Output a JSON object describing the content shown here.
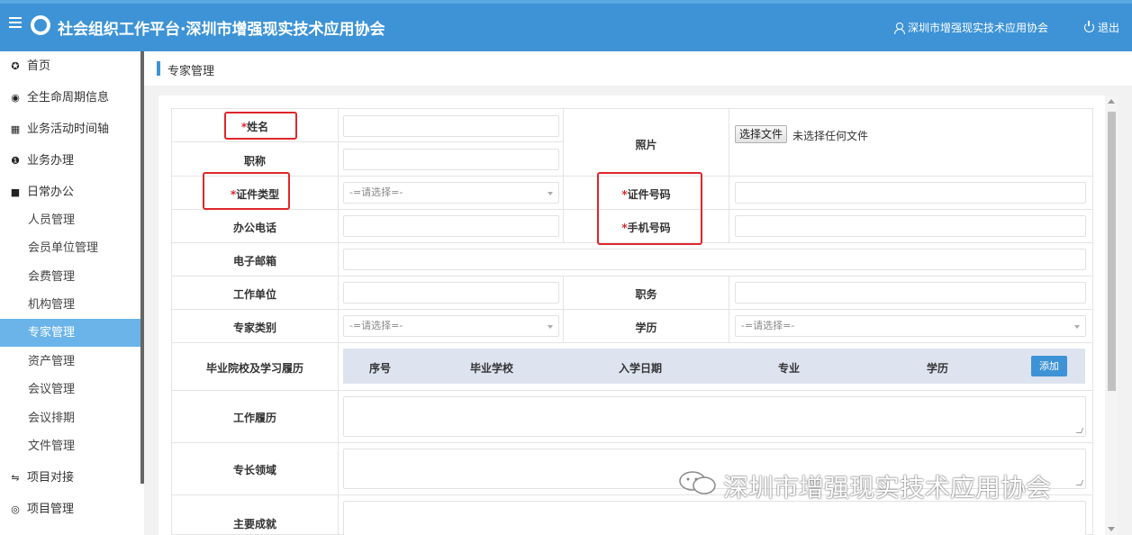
{
  "header": {
    "title": "社会组织工作平台·深圳市增强现实技术应用协会",
    "user": "深圳市增强现实技术应用协会",
    "logout": "退出"
  },
  "sidebar": {
    "items": [
      {
        "label": "首页",
        "icon": "dashboard-icon",
        "glyph": "✪"
      },
      {
        "label": "全生命周期信息",
        "icon": "eye-icon",
        "glyph": "◉"
      },
      {
        "label": "业务活动时间轴",
        "icon": "calendar-icon",
        "glyph": "▦"
      },
      {
        "label": "业务办理",
        "icon": "info-icon",
        "glyph": "❶"
      },
      {
        "label": "日常办公",
        "icon": "briefcase-icon",
        "glyph": "■"
      }
    ],
    "subitems": [
      "人员管理",
      "会员单位管理",
      "会费管理",
      "机构管理",
      "专家管理",
      "资产管理",
      "会议管理",
      "会议排期",
      "文件管理"
    ],
    "bottom": [
      {
        "label": "项目对接",
        "icon": "handshake-icon",
        "glyph": "⇋"
      },
      {
        "label": "项目管理",
        "icon": "eye-outline-icon",
        "glyph": "◎"
      }
    ]
  },
  "breadcrumb": "专家管理",
  "form": {
    "name": "姓名",
    "photo": "照片",
    "title": "职称",
    "id_type": "证件类型",
    "id_number": "证件号码",
    "office_phone": "办公电话",
    "mobile": "手机号码",
    "email": "电子邮箱",
    "work_unit": "工作单位",
    "position": "职务",
    "expert_type": "专家类别",
    "education": "学历",
    "edu_history": "毕业院校及学习履历",
    "work_history": "工作履历",
    "specialty": "专长领域",
    "achievements": "主要成就",
    "select_placeholder": "-=请选择=-",
    "file_button": "选择文件",
    "file_status": "未选择任何文件",
    "edu_columns": [
      "序号",
      "毕业学校",
      "入学日期",
      "专业",
      "学历"
    ],
    "add_button": "添加"
  },
  "watermark": "深圳市增强现实技术应用协会"
}
